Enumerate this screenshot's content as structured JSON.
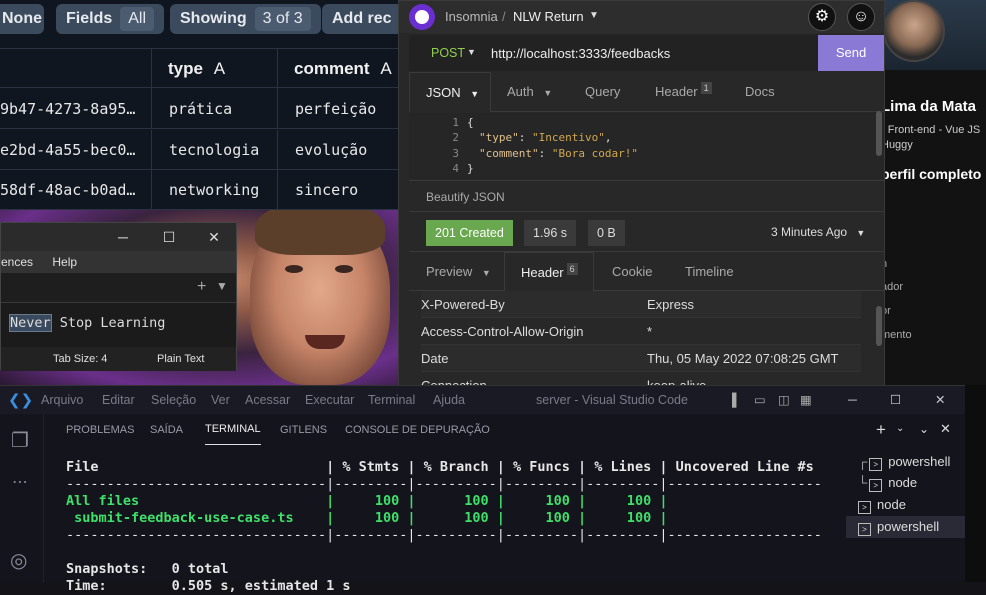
{
  "table_app": {
    "filters": {
      "value": "None"
    },
    "fields": {
      "label": "Fields",
      "value": "All"
    },
    "showing": {
      "label": "Showing",
      "value": "3 of 3"
    },
    "add_record": {
      "label": "Add rec"
    },
    "columns": [
      {
        "name": "type",
        "type_marker": "A"
      },
      {
        "name": "comment",
        "type_marker": "A"
      }
    ],
    "rows": [
      {
        "id": "9b47-4273-8a95…",
        "type": "prática",
        "comment": "perfeição"
      },
      {
        "id": "e2bd-4a55-bec0…",
        "type": "tecnologia",
        "comment": "evolução"
      },
      {
        "id": "58df-48ac-b0ad…",
        "type": "networking",
        "comment": "sincero"
      }
    ]
  },
  "editor": {
    "menu": [
      "ences",
      "Help"
    ],
    "text_selected": "Never",
    "text_rest": " Stop Learning",
    "tab_size": "Tab Size: 4",
    "mode": "Plain Text"
  },
  "insomnia": {
    "app_name": "Insomnia",
    "separator": "/",
    "collection": "NLW Return",
    "method": "POST",
    "url": "http://localhost:3333/feedbacks",
    "send_label": "Send",
    "request_tabs": [
      {
        "label": "JSON"
      },
      {
        "label": "Auth"
      },
      {
        "label": "Query"
      },
      {
        "label": "Header",
        "badge": "1"
      },
      {
        "label": "Docs"
      }
    ],
    "body_lines": [
      {
        "n": "1",
        "text": "{"
      },
      {
        "n": "2",
        "key": "\"type\"",
        "value": "\"Incentivo\"",
        "suffix": ","
      },
      {
        "n": "3",
        "key": "\"comment\"",
        "value": "\"Bora codar!\"",
        "suffix": ""
      },
      {
        "n": "4",
        "text": "}"
      }
    ],
    "beautify": "Beautify JSON",
    "status": "201 Created",
    "time": "1.96 s",
    "size": "0 B",
    "when": "3 Minutes Ago",
    "response_tabs": [
      {
        "label": "Preview"
      },
      {
        "label": "Header",
        "badge": "6"
      },
      {
        "label": "Cookie"
      },
      {
        "label": "Timeline"
      }
    ],
    "headers": [
      {
        "name": "X-Powered-By",
        "value": "Express"
      },
      {
        "name": "Access-Control-Allow-Origin",
        "value": "*"
      },
      {
        "name": "Date",
        "value": "Thu, 05 May 2022 07:08:25 GMT"
      },
      {
        "name": "Connection",
        "value": "keep-alive"
      }
    ]
  },
  "profile": {
    "name": "Lima da Mata",
    "line1": "r Front-end - Vue JS",
    "line2": "Huggy",
    "heading": "perfil completo",
    "items": [
      "n",
      "ador",
      "or",
      "mento"
    ]
  },
  "vscode": {
    "menu": [
      "Arquivo",
      "Editar",
      "Seleção",
      "Ver",
      "Acessar",
      "Executar",
      "Terminal",
      "Ajuda"
    ],
    "title": "server - Visual Studio Code",
    "panel_tabs": [
      "PROBLEMAS",
      "SAÍDA",
      "TERMINAL",
      "GITLENS",
      "CONSOLE DE DEPURAÇÃO"
    ],
    "coverage_header": "File                            | % Stmts | % Branch | % Funcs | % Lines | Uncovered Line #s",
    "coverage_sep": "--------------------------------|---------|----------|---------|---------|-------------------",
    "coverage_all": "All files                       |     100 |      100 |     100 |     100 |",
    "coverage_file": " submit-feedback-use-case.ts    |     100 |      100 |     100 |     100 |",
    "snapshots": "Snapshots:   0 total",
    "time": "Time:        0.505 s, estimated 1 s",
    "terminals": [
      "powershell",
      "node",
      "node",
      "powershell"
    ]
  }
}
